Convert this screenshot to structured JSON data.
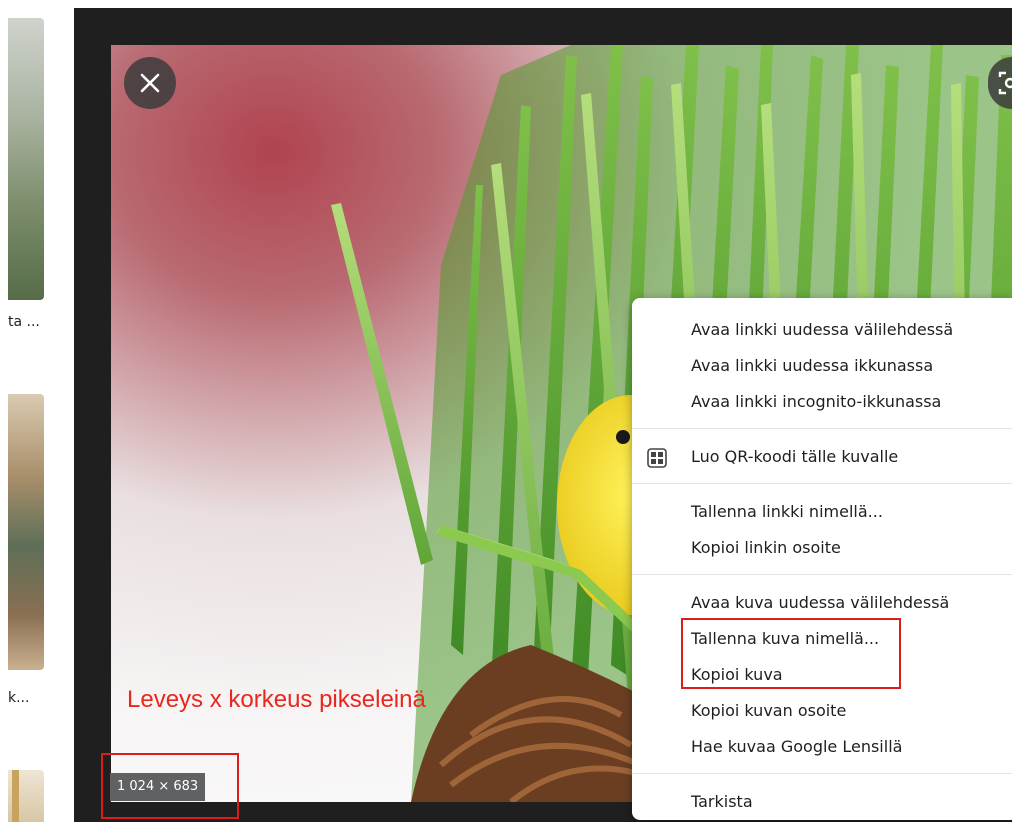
{
  "results": {
    "captions": [
      "ta ...",
      "k..."
    ]
  },
  "viewer": {
    "image_dimensions": "1 024 × 683",
    "close_icon": "close-icon",
    "lens_icon": "lens-icon"
  },
  "annotation": {
    "text": "Leveys x korkeus pikseleinä",
    "color": "#e8281e"
  },
  "context_menu": {
    "items": [
      {
        "label": "Avaa linkki uudessa välilehdessä"
      },
      {
        "label": "Avaa linkki uudessa ikkunassa"
      },
      {
        "label": "Avaa linkki incognito-ikkunassa"
      },
      {
        "label": "Luo QR-koodi tälle kuvalle",
        "icon": "qr-code-icon"
      },
      {
        "label": "Tallenna linkki nimellä..."
      },
      {
        "label": "Kopioi linkin osoite"
      },
      {
        "label": "Avaa kuva uudessa välilehdessä"
      },
      {
        "label": "Tallenna kuva nimellä..."
      },
      {
        "label": "Kopioi kuva"
      },
      {
        "label": "Kopioi kuvan osoite"
      },
      {
        "label": "Hae kuvaa Google Lensillä"
      },
      {
        "label": "Tarkista"
      }
    ]
  }
}
